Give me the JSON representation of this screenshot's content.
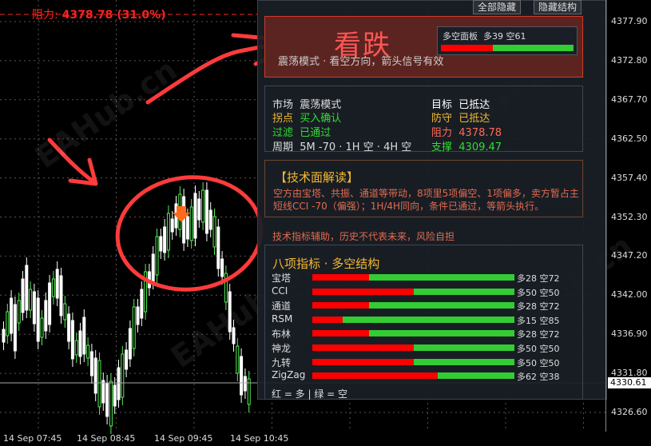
{
  "resistance_line": {
    "label": "阻力:",
    "value": "4378.78 (31.0%)"
  },
  "top_buttons": {
    "show_all": "全部隐藏",
    "hide_structure": "隐藏结构"
  },
  "signal": {
    "title": "看跌",
    "subtitle": "震荡模式 · 看空方向，箭头信号有效",
    "panel_label": "多空面板",
    "long_label": "多39",
    "short_label": "空61",
    "long_pct": 39,
    "short_pct": 61
  },
  "info": {
    "market_label": "市场",
    "market_value": "震荡模式",
    "turn_label": "拐点",
    "turn_value": "买入确认",
    "filter_label": "过滤",
    "filter_value": "已通过",
    "period_label": "周期",
    "period_value": "5M -70 · 1H 空 · 4H 空",
    "target_label": "目标",
    "target_value": "已抵达",
    "defense_label": "防守",
    "defense_value": "已抵达",
    "resist_label": "阻力",
    "resist_value": "4378.78",
    "support_label": "支撑",
    "support_value": "4309.47"
  },
  "tech": {
    "title": "【技术面解读】",
    "body": "空方由宝塔、共振、通道等带动，8项里5项偏空、1项偏多，卖方暂占主 短线CCI -70（偏强）；1H/4H同向，条件已通过，等箭头执行。"
  },
  "disclaimer": "技术指标辅助，历史不代表未来，风险自担",
  "indicators": {
    "title": "八项指标 · 多空结构",
    "rows": [
      {
        "name": "宝塔",
        "long": 28,
        "short": 72,
        "text": "多28 空72"
      },
      {
        "name": "CCI",
        "long": 50,
        "short": 50,
        "text": "多50 空50"
      },
      {
        "name": "通道",
        "long": 28,
        "short": 72,
        "text": "多28 空72"
      },
      {
        "name": "RSM",
        "long": 15,
        "short": 85,
        "text": "多15 空85"
      },
      {
        "name": "布林",
        "long": 28,
        "short": 72,
        "text": "多28 空72"
      },
      {
        "name": "神龙",
        "long": 50,
        "short": 50,
        "text": "多50 空50"
      },
      {
        "name": "九转",
        "long": 50,
        "short": 50,
        "text": "多50 空50"
      },
      {
        "name": "ZigZag",
        "long": 62,
        "short": 38,
        "text": "多62 空38"
      }
    ],
    "legend": "红 = 多  |  绿 = 空"
  },
  "price_axis": [
    "4377.90",
    "4372.80",
    "4367.70",
    "4362.50",
    "4357.40",
    "4352.30",
    "4347.20",
    "4342.00",
    "4336.90",
    "4331.80",
    "4326.60"
  ],
  "current_price": "4330.61",
  "time_axis": [
    "14 Sep 07:45",
    "14 Sep 08:45",
    "14 Sep 09:45",
    "14 Sep 10:45"
  ],
  "watermark": "EAHub.cn",
  "colors": {
    "bull": "#ff0000",
    "bear": "#33cc33",
    "candle_up": "#ffffff",
    "candle_down": "#55ee55",
    "annotation": "#ff3b3b",
    "accent": "#f2b830"
  }
}
